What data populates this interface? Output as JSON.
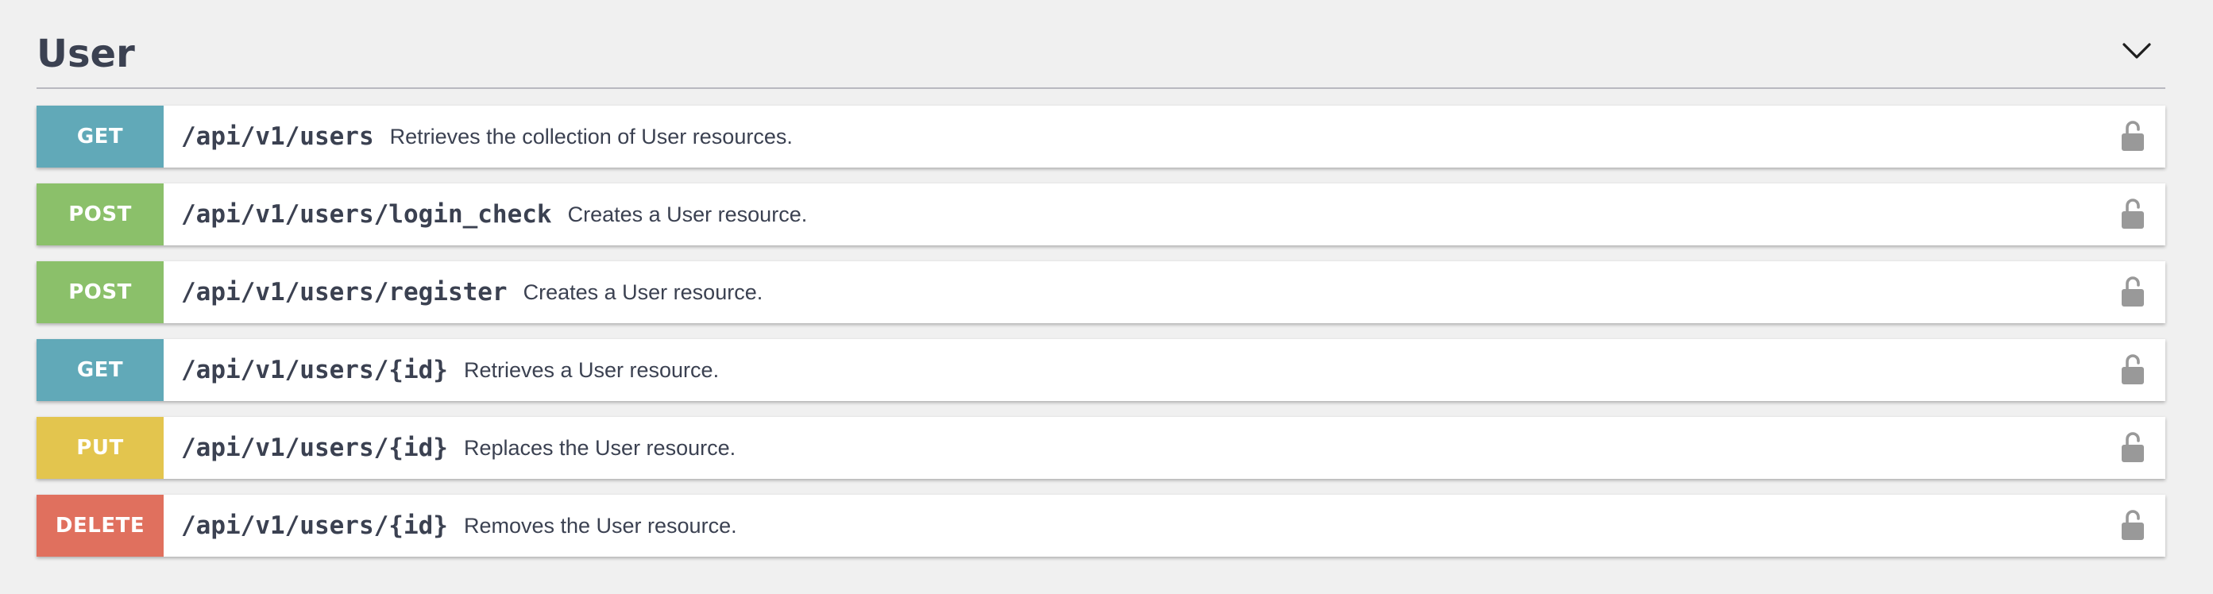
{
  "section": {
    "title": "User",
    "toggle_icon": "chevron-down-icon"
  },
  "colors": {
    "GET": "#61a9b8",
    "POST": "#8bc06a",
    "PUT": "#e3c54e",
    "DELETE": "#e0705e",
    "lock": "#999999"
  },
  "operations": [
    {
      "method": "GET",
      "path": "/api/v1/users",
      "summary": "Retrieves the collection of User resources.",
      "lock_icon": "unlocked-padlock-icon"
    },
    {
      "method": "POST",
      "path": "/api/v1/users/login_check",
      "summary": "Creates a User resource.",
      "lock_icon": "unlocked-padlock-icon"
    },
    {
      "method": "POST",
      "path": "/api/v1/users/register",
      "summary": "Creates a User resource.",
      "lock_icon": "unlocked-padlock-icon"
    },
    {
      "method": "GET",
      "path": "/api/v1/users/{id}",
      "summary": "Retrieves a User resource.",
      "lock_icon": "unlocked-padlock-icon"
    },
    {
      "method": "PUT",
      "path": "/api/v1/users/{id}",
      "summary": "Replaces the User resource.",
      "lock_icon": "unlocked-padlock-icon"
    },
    {
      "method": "DELETE",
      "path": "/api/v1/users/{id}",
      "summary": "Removes the User resource.",
      "lock_icon": "unlocked-padlock-icon"
    }
  ]
}
